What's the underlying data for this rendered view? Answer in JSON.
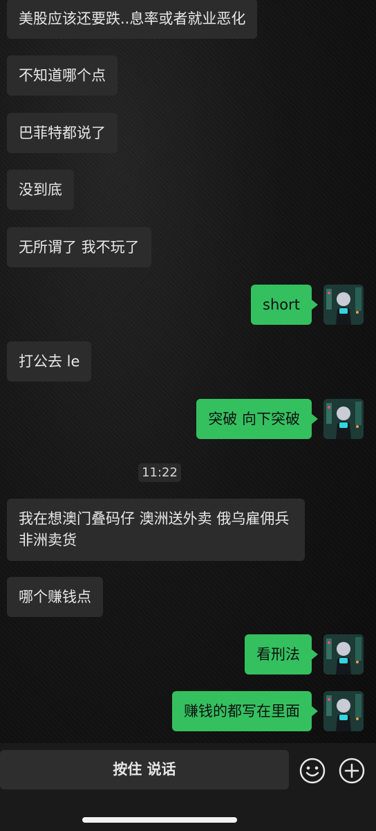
{
  "messages": [
    {
      "sender": "other",
      "text": "美股应该还要跌..息率或者就业恶化"
    },
    {
      "sender": "other",
      "text": "不知道哪个点"
    },
    {
      "sender": "other",
      "text": "巴菲特都说了"
    },
    {
      "sender": "other",
      "text": "没到底"
    },
    {
      "sender": "other",
      "text": "无所谓了 我不玩了"
    },
    {
      "sender": "me",
      "text": "short"
    },
    {
      "sender": "other",
      "text": "打公去 le"
    },
    {
      "sender": "me",
      "text": "突破 向下突破"
    },
    {
      "sender": "other",
      "text": "我在想澳门叠码仔 澳洲送外卖 俄乌雇佣兵 非洲卖货"
    },
    {
      "sender": "other",
      "text": "哪个赚钱点"
    },
    {
      "sender": "me",
      "text": "看刑法"
    },
    {
      "sender": "me",
      "text": "赚钱的都写在里面"
    }
  ],
  "timestamp": "11:22",
  "input_bar": {
    "hold_to_talk_label": "按住 说话",
    "emoji_icon": "emoji-smiley-icon",
    "more_icon": "plus-circle-icon"
  },
  "colors": {
    "outgoing_bubble": "#35c060",
    "incoming_bubble": "#2c2c2c",
    "background": "#121212"
  }
}
